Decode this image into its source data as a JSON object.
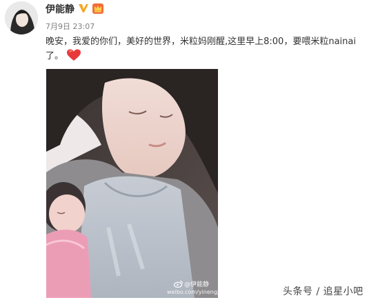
{
  "post": {
    "author": "伊能静",
    "timestamp": "7月9日 23:07",
    "text_line1": "晚安，我爱的你们，美好的世界，米粒妈刚醒,这里早上8:00，要喂米粒nainai",
    "text_line2": "了。"
  },
  "icons": {
    "verified": "verified-badge-icon",
    "crown": "vip-crown-icon",
    "heart": "heart-emoji-icon",
    "weibo_logo": "weibo-logo-icon"
  },
  "photo": {
    "watermark_handle": "@伊能静",
    "watermark_url": "weibo.com/yinengjing"
  },
  "source_watermark": "头条号 / 追星小吧",
  "colors": {
    "verified": "#f5a623",
    "crown": "#f26d3d",
    "heart": "#e8393a"
  }
}
